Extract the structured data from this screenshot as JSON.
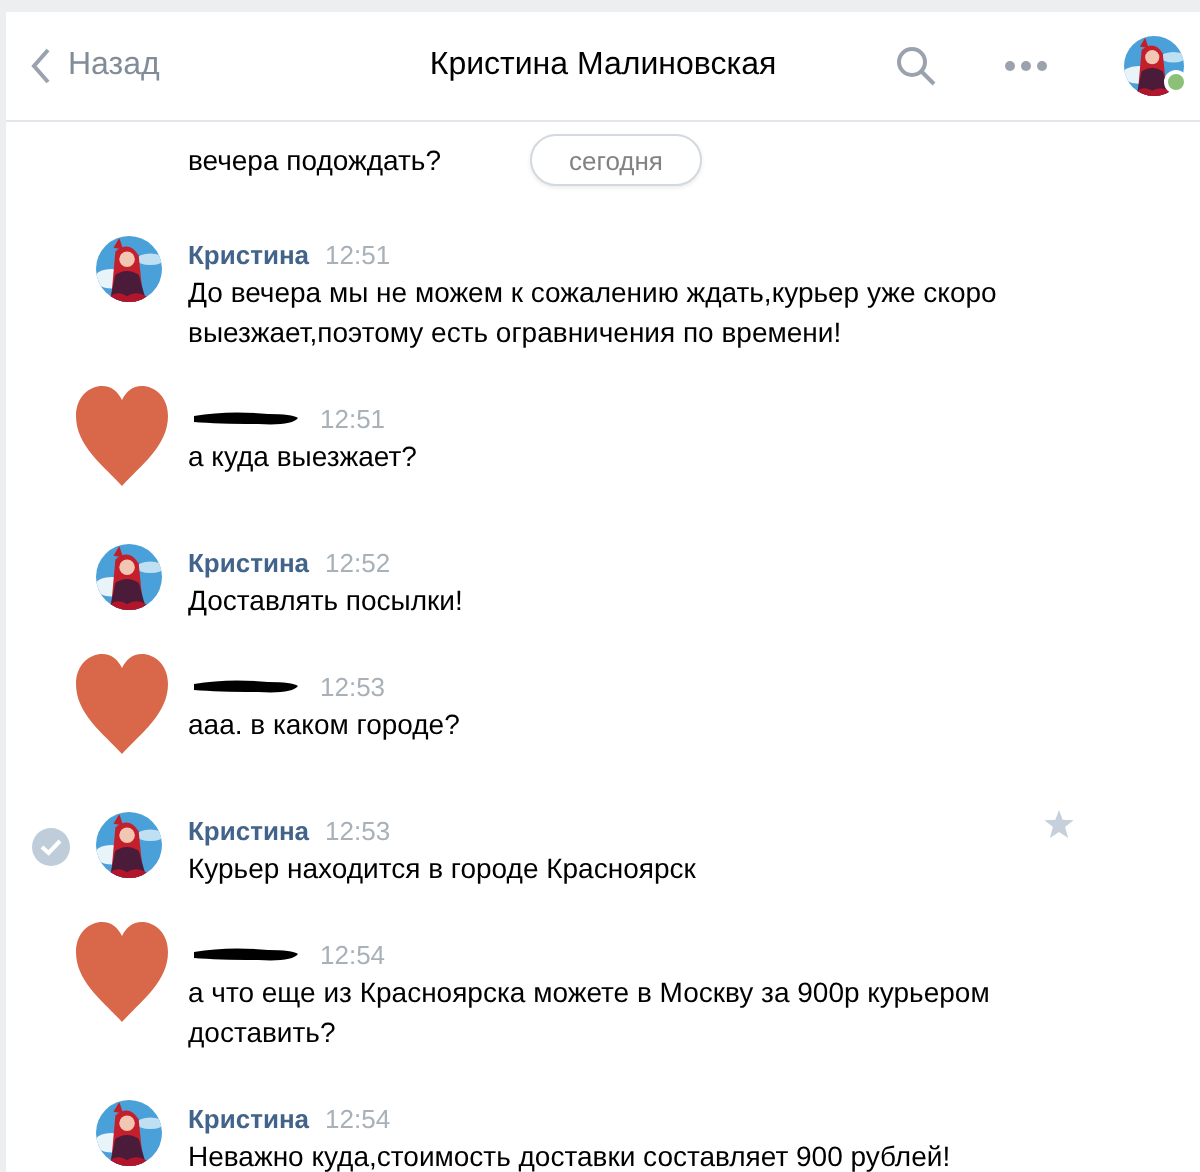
{
  "header": {
    "back_label": "Назад",
    "title": "Кристина Малиновская",
    "online": true
  },
  "partial_message": {
    "text": "вечера подождать?"
  },
  "date_divider": "сегодня",
  "messages": [
    {
      "kind": "contact",
      "sender": "Кристина",
      "time": "12:51",
      "text": "До вечера мы не можем к сожалению ждать,курьер уже скоро выезжает,поэтому есть огравничения по времени!",
      "selected": false
    },
    {
      "kind": "redacted",
      "time": "12:51",
      "text": "а куда выезжает?",
      "selected": false
    },
    {
      "kind": "contact",
      "sender": "Кристина",
      "time": "12:52",
      "text": "Доставлять посылки!",
      "selected": false
    },
    {
      "kind": "redacted",
      "time": "12:53",
      "text": "ааа. в каком городе?",
      "selected": false
    },
    {
      "kind": "contact",
      "sender": "Кристина",
      "time": "12:53",
      "text": "Курьер находится в городе Красноярск",
      "selected": true
    },
    {
      "kind": "redacted",
      "time": "12:54",
      "text": "а что еще из Красноярска можете в Москву за 900р курьером доставить?",
      "selected": false
    },
    {
      "kind": "contact",
      "sender": "Кристина",
      "time": "12:54",
      "text": "Неважно куда,стоимость доставки составляет 900 рублей!",
      "selected": false
    }
  ]
}
